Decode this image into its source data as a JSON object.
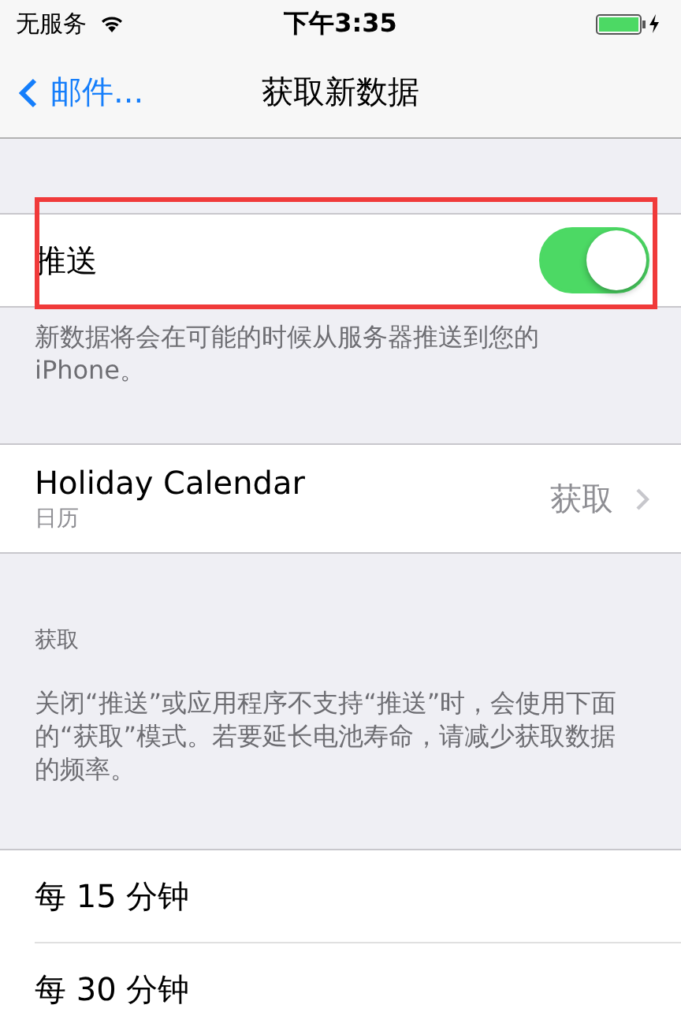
{
  "status_bar": {
    "carrier": "无服务",
    "time": "下午3:35",
    "charging": true
  },
  "nav": {
    "back": "邮件...",
    "title": "获取新数据"
  },
  "push": {
    "label": "推送",
    "on": true,
    "highlighted": true,
    "footer": "新数据将会在可能的时候从服务器推送到您的iPhone。"
  },
  "accounts": [
    {
      "name": "Holiday Calendar",
      "subtitle": "日历",
      "value": "获取"
    }
  ],
  "fetch": {
    "header": "获取",
    "footer": "关闭“推送”或应用程序不支持“推送”时，会使用下面的“获取”模式。若要延长电池寿命，请减少获取数据的频率。",
    "options": [
      {
        "label": "每 15 分钟"
      },
      {
        "label": "每 30 分钟"
      }
    ]
  }
}
